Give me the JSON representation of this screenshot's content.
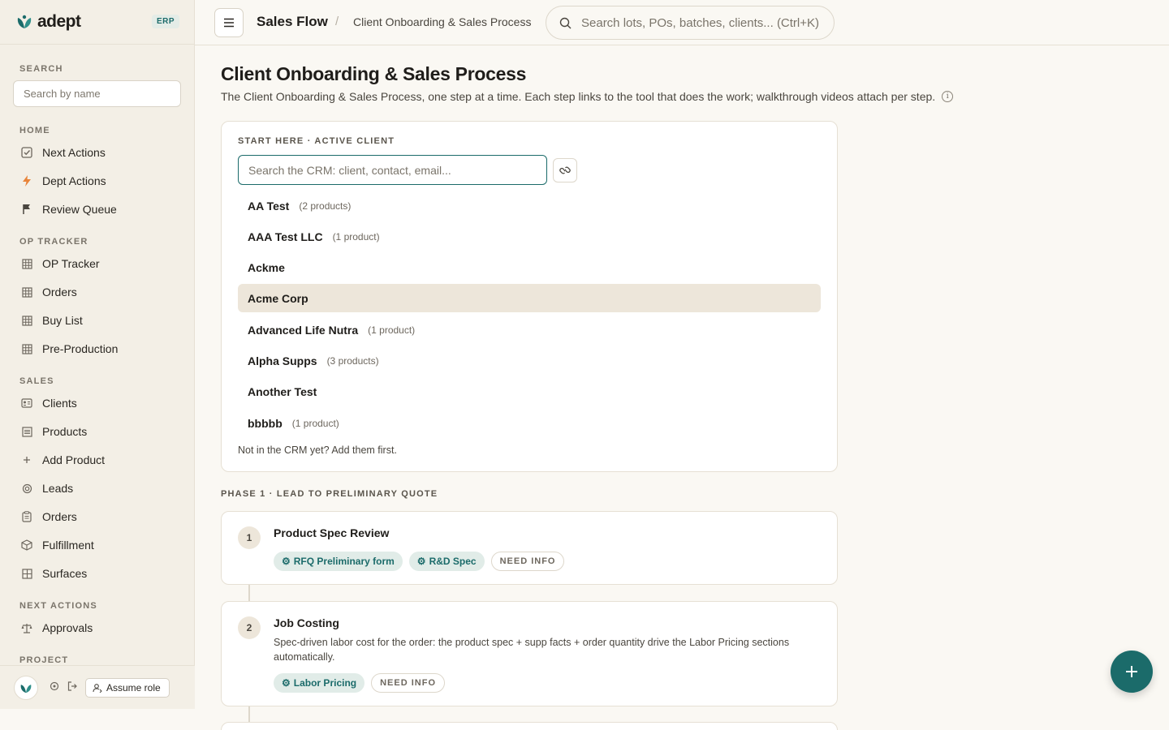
{
  "brand": {
    "name": "adept",
    "badge": "ERP"
  },
  "sidebar": {
    "search_label": "SEARCH",
    "search_placeholder": "Search by name",
    "sections": [
      {
        "label": "HOME",
        "items": [
          {
            "label": "Next Actions",
            "icon": "checkbox-icon"
          },
          {
            "label": "Dept Actions",
            "icon": "bolt-icon"
          },
          {
            "label": "Review Queue",
            "icon": "flag-icon"
          }
        ]
      },
      {
        "label": "OP TRACKER",
        "items": [
          {
            "label": "OP Tracker",
            "icon": "grid-icon"
          },
          {
            "label": "Orders",
            "icon": "grid-icon"
          },
          {
            "label": "Buy List",
            "icon": "grid-icon"
          },
          {
            "label": "Pre-Production",
            "icon": "grid-icon"
          }
        ]
      },
      {
        "label": "SALES",
        "items": [
          {
            "label": "Clients",
            "icon": "id-card-icon"
          },
          {
            "label": "Products",
            "icon": "list-icon"
          },
          {
            "label": "Add Product",
            "icon": "plus-icon"
          },
          {
            "label": "Leads",
            "icon": "target-icon"
          },
          {
            "label": "Orders",
            "icon": "clipboard-icon"
          },
          {
            "label": "Fulfillment",
            "icon": "box-icon"
          },
          {
            "label": "Surfaces",
            "icon": "layout-icon"
          }
        ]
      },
      {
        "label": "NEXT ACTIONS",
        "items": [
          {
            "label": "Approvals",
            "icon": "scale-icon"
          }
        ]
      },
      {
        "label": "PROJECT",
        "items": []
      }
    ],
    "footer": {
      "assume_role": "Assume role"
    }
  },
  "topbar": {
    "breadcrumb_main": "Sales Flow",
    "breadcrumb_sep": "/",
    "breadcrumb_sub": "Client Onboarding & Sales Process",
    "search_placeholder": "Search lots, POs, batches, clients... (Ctrl+K)"
  },
  "page": {
    "title": "Client Onboarding & Sales Process",
    "description": "The Client Onboarding & Sales Process, one step at a time. Each step links to the tool that does the work; walkthrough videos attach per step."
  },
  "start_card": {
    "label": "START HERE · ACTIVE CLIENT",
    "search_placeholder": "Search the CRM: client, contact, email...",
    "clients": [
      {
        "name": "AA Test",
        "count": "(2 products)",
        "active": false
      },
      {
        "name": "AAA Test LLC",
        "count": "(1 product)",
        "active": false
      },
      {
        "name": "Ackme",
        "count": "",
        "active": false
      },
      {
        "name": "Acme Corp",
        "count": "",
        "active": true
      },
      {
        "name": "Advanced Life Nutra",
        "count": "(1 product)",
        "active": false
      },
      {
        "name": "Alpha Supps",
        "count": "(3 products)",
        "active": false
      },
      {
        "name": "Another Test",
        "count": "",
        "active": false
      },
      {
        "name": "bbbbb",
        "count": "(1 product)",
        "active": false
      }
    ],
    "footer_note": "Not in the CRM yet? Add them first."
  },
  "phase1": {
    "label": "PHASE 1 · LEAD TO PRELIMINARY QUOTE",
    "steps": [
      {
        "num": "1",
        "title": "Product Spec Review",
        "desc": "",
        "tools": [
          "RFQ Preliminary form",
          "R&D Spec"
        ],
        "status": "NEED INFO"
      },
      {
        "num": "2",
        "title": "Job Costing",
        "desc": "Spec-driven labor cost for the order: the product spec + supp facts + order quantity drive the Labor Pricing sections automatically.",
        "tools": [
          "Labor Pricing"
        ],
        "status": "NEED INFO"
      }
    ]
  },
  "colors": {
    "accent": "#1b6b6a",
    "background": "#faf8f3",
    "sidebar": "#f3efe6",
    "active_row": "#ede6da"
  }
}
